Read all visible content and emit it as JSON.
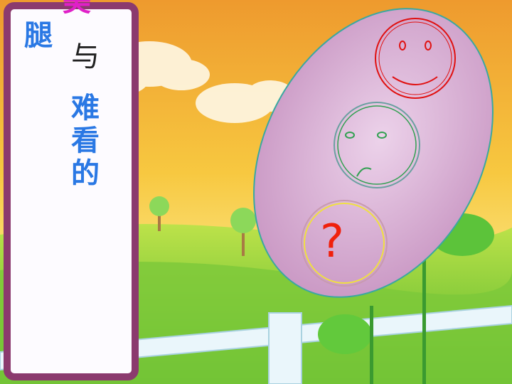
{
  "panel": {
    "magenta_char": "美",
    "column_left": "腿",
    "column_middle_top": "与",
    "column_middle_bottom": "难看的"
  },
  "faces": {
    "smile_label": "smiling-face",
    "sad_label": "sad-face",
    "unknown_text": "?"
  },
  "colors": {
    "panel_frame": "#8b3a6e",
    "panel_fill": "#ffffff",
    "text_blue": "#2a78e4",
    "text_magenta": "#e020c8",
    "oval_fill": "#d8a8d0",
    "oval_stroke": "#3aa8a0",
    "smile_face": "#e01010",
    "sad_face": "#30a050",
    "question_circle": "#f0e040",
    "question_mark": "#f0200c",
    "sky_top": "#f0a030",
    "grass": "#7ed03a"
  }
}
